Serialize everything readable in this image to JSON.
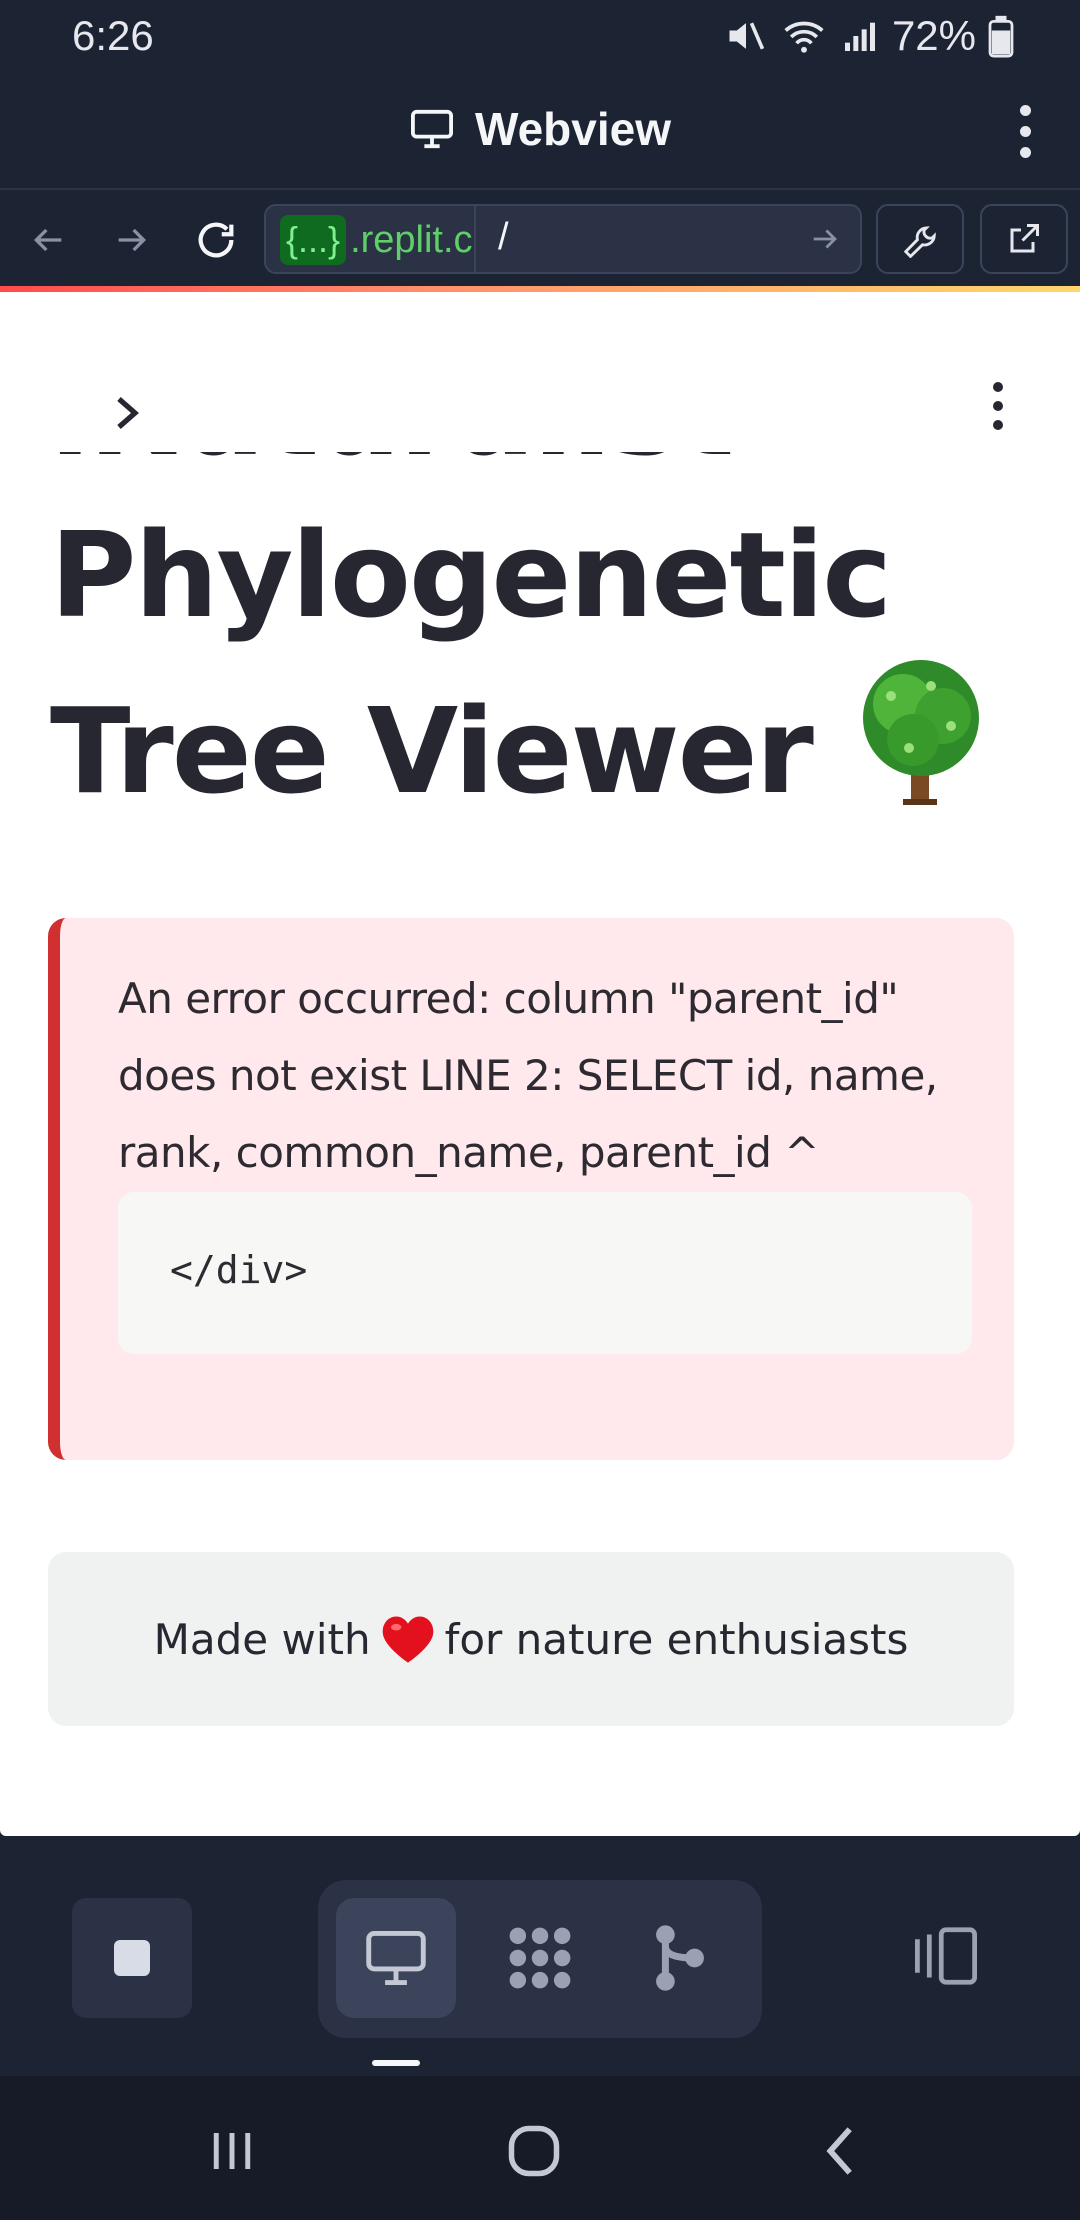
{
  "status_bar": {
    "time": "6:26",
    "battery": "72%"
  },
  "webview": {
    "title": "Webview"
  },
  "url_bar": {
    "badge": "{...}",
    "host": ".replit.c",
    "path": "/"
  },
  "page": {
    "title_line1": "iNaturalist",
    "title_line2": "Phylogenetic",
    "title_line3": "Tree Viewer",
    "error_message": "An error occurred: column \"parent_id\" does not exist LINE 2: SELECT id, name, rank, common_name, parent_id ^",
    "code": "</div>",
    "footer_before": "Made with",
    "footer_after": "for nature enthusiasts"
  },
  "colors": {
    "error_border": "#d03030",
    "error_bg": "#ffe9ec",
    "footer_bg": "#eff2f0",
    "accent_green": "#5fd068"
  },
  "icons": [
    "back-arrow-icon",
    "forward-arrow-icon",
    "reload-icon",
    "wrench-icon",
    "external-link-icon",
    "monitor-icon",
    "tree-emoji-icon",
    "heart-emoji-icon",
    "stop-icon",
    "packages-icon",
    "git-icon",
    "layout-icon"
  ]
}
